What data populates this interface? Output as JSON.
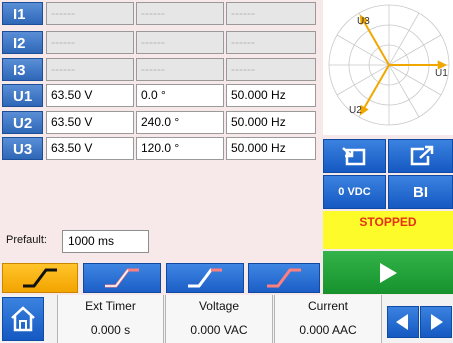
{
  "channels": [
    {
      "label": "I1",
      "magnitude": "------",
      "phase": "------",
      "frequency": "------",
      "active": false
    },
    {
      "label": "I2",
      "magnitude": "------",
      "phase": "------",
      "frequency": "------",
      "active": false
    },
    {
      "label": "I3",
      "magnitude": "------",
      "phase": "------",
      "frequency": "------",
      "active": false
    },
    {
      "label": "U1",
      "magnitude": "63.50 V",
      "phase": "0.0 °",
      "frequency": "50.000 Hz",
      "active": true
    },
    {
      "label": "U2",
      "magnitude": "63.50 V",
      "phase": "240.0 °",
      "frequency": "50.000 Hz",
      "active": true
    },
    {
      "label": "U3",
      "magnitude": "63.50 V",
      "phase": "120.0 °",
      "frequency": "50.000 Hz",
      "active": true
    }
  ],
  "phasor": {
    "vectors": [
      {
        "label": "U1",
        "angle_deg": 0
      },
      {
        "label": "U2",
        "angle_deg": 240
      },
      {
        "label": "U3",
        "angle_deg": 120
      }
    ],
    "vector_color": "#f0a800"
  },
  "controls": {
    "dc_button": "0 VDC",
    "bi_button": "BI",
    "status": "STOPPED",
    "import_icon": "import-icon",
    "export_icon": "export-icon",
    "play_icon": "play-icon"
  },
  "prefault": {
    "label": "Prefault:",
    "value": "1000 ms"
  },
  "ramp_tabs": [
    {
      "name": "ramp-tab-1",
      "active": true
    },
    {
      "name": "ramp-tab-2",
      "active": false
    },
    {
      "name": "ramp-tab-3",
      "active": false
    },
    {
      "name": "ramp-tab-4",
      "active": false
    }
  ],
  "statusbar": {
    "ext_timer": {
      "title": "Ext Timer",
      "value": "0.000 s"
    },
    "voltage": {
      "title": "Voltage",
      "value": "0.000 VAC"
    },
    "current": {
      "title": "Current",
      "value": "0.000 AAC"
    }
  },
  "colors": {
    "background": "#f7e9e9",
    "blue": "#2f6fcf",
    "yellow": "#fdfb2a",
    "green": "#1fa13a",
    "orange": "#f4a600",
    "stopped_text": "#e43217"
  }
}
